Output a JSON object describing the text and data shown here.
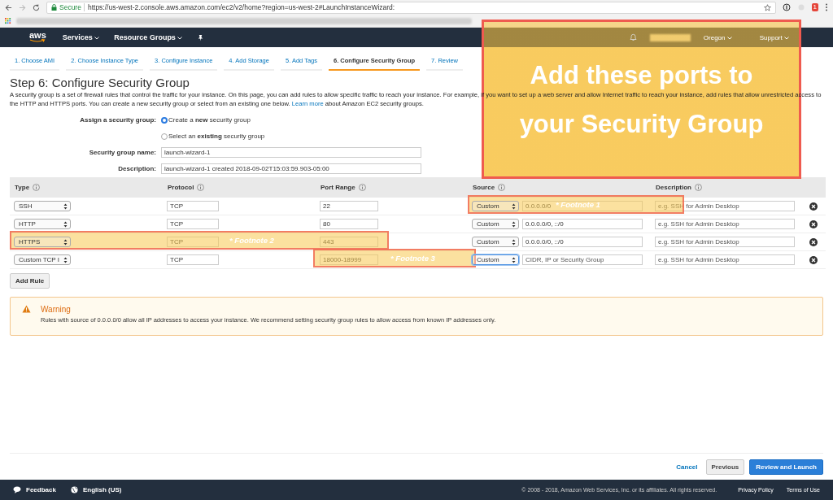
{
  "browser": {
    "secure_label": "Secure",
    "url": "https://us-west-2.console.aws.amazon.com/ec2/v2/home?region=us-west-2#LaunchInstanceWizard:",
    "extension_badge": "1"
  },
  "nav": {
    "logo": "aws",
    "menus": [
      "Services",
      "Resource Groups"
    ],
    "right_menus": [
      "Oregon",
      "Support"
    ]
  },
  "wizard_tabs": [
    {
      "label": "1. Choose AMI",
      "selected": false
    },
    {
      "label": "2. Choose Instance Type",
      "selected": false
    },
    {
      "label": "3. Configure Instance",
      "selected": false
    },
    {
      "label": "4. Add Storage",
      "selected": false
    },
    {
      "label": "5. Add Tags",
      "selected": false
    },
    {
      "label": "6. Configure Security Group",
      "selected": true
    },
    {
      "label": "7. Review",
      "selected": false
    }
  ],
  "page": {
    "title": "Step 6: Configure Security Group",
    "intro": "A security group is a set of firewall rules that control the traffic for your instance. On this page, you can add rules to allow specific traffic to reach your instance. For example, if you want to set up a web server and allow Internet traffic to reach your instance, add rules that allow unrestricted access to the HTTP and HTTPS ports. You can create a new security group or select from an existing one below. ",
    "learn_more": "Learn more",
    "intro_tail": " about Amazon EC2 security groups."
  },
  "assign": {
    "label": "Assign a security group:",
    "options": [
      {
        "label": "Create a **new** security group",
        "selected": true
      },
      {
        "label": "Select an **existing** security group",
        "selected": false
      }
    ]
  },
  "fields": [
    {
      "label": "Security group name:",
      "value": "launch-wizard-1"
    },
    {
      "label": "Description:",
      "value": "launch-wizard-1 created 2018-09-02T15:03:59.903-05:00"
    }
  ],
  "table": {
    "columns": [
      "Type",
      "Protocol",
      "Port Range",
      "Source",
      "Description"
    ],
    "rows": [
      {
        "type": "SSH",
        "protocol": "TCP",
        "port_range": "22",
        "source": "Custom",
        "source_focused": false,
        "source_value": "0.0.0.0/0",
        "description_placeholder": "e.g. SSH for Admin Desktop"
      },
      {
        "type": "HTTP",
        "protocol": "TCP",
        "port_range": "80",
        "source": "Custom",
        "source_focused": false,
        "source_value": "0.0.0.0/0, ::/0",
        "description_placeholder": "e.g. SSH for Admin Desktop"
      },
      {
        "type": "HTTPS",
        "protocol": "TCP",
        "port_range": "443",
        "source": "Custom",
        "source_focused": false,
        "source_value": "0.0.0.0/0, ::/0",
        "description_placeholder": "e.g. SSH for Admin Desktop"
      },
      {
        "type": "Custom TCP I",
        "protocol": "TCP",
        "port_range": "18000-18999",
        "source": "Custom",
        "source_focused": true,
        "source_placeholder": "CIDR, IP or Security Group",
        "description_placeholder": "e.g. SSH for Admin Desktop"
      }
    ]
  },
  "add_rule": "Add Rule",
  "warning": {
    "title": "Warning",
    "text": "Rules with source of 0.0.0.0/0 allow all IP addresses to access your instance. We recommend setting security group rules to allow access from known IP addresses only."
  },
  "actions": {
    "cancel": "Cancel",
    "previous": "Previous",
    "primary": "Review and Launch"
  },
  "footer": {
    "feedback": "Feedback",
    "language": "English (US)",
    "copyright": "© 2008 - 2018, Amazon Web Services, Inc. or its affiliates. All rights reserved.",
    "links": [
      "Privacy Policy",
      "Terms of Use"
    ]
  },
  "callouts": [
    {
      "kind": "main",
      "lines": [
        "Add these ports to",
        "your Security Group"
      ]
    },
    {
      "kind": "footnote",
      "text": "* Footnote 1"
    },
    {
      "kind": "footnote",
      "text": "* Footnote 2"
    },
    {
      "kind": "footnote",
      "text": "* Footnote 3"
    }
  ]
}
